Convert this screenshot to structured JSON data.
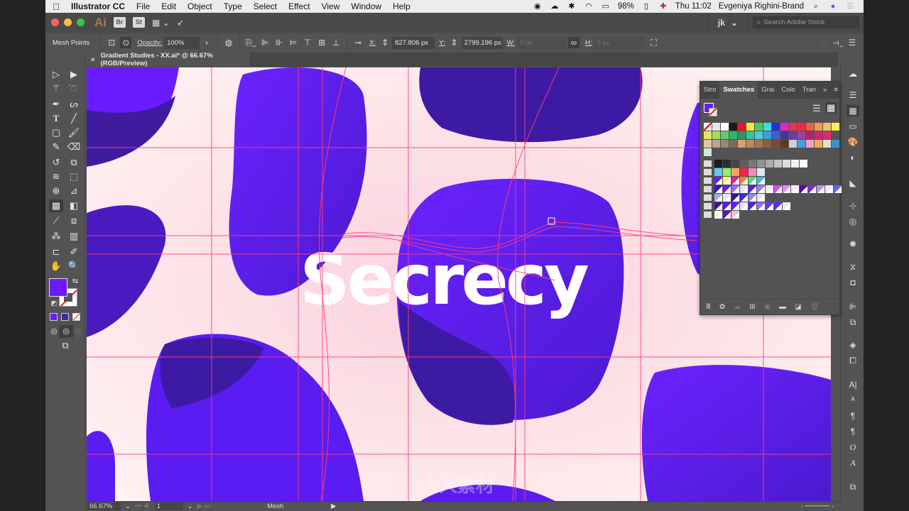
{
  "menubar": {
    "app_name": "Illustrator CC",
    "items": [
      "File",
      "Edit",
      "Object",
      "Type",
      "Select",
      "Effect",
      "View",
      "Window",
      "Help"
    ],
    "battery": "98%",
    "clock": "Thu 11:02",
    "user": "Evgeniya Righini-Brand"
  },
  "appbar": {
    "logo": "Ai",
    "bridge_label": "Br",
    "stock_label": "St",
    "workspace_user": "jk",
    "search_placeholder": "Search Adobe Stock"
  },
  "control_bar": {
    "selection_label": "Mesh Points",
    "opacity_label": "Opacity:",
    "opacity_value": "100%",
    "x_label": "X:",
    "x_value": "827.806 px",
    "y_label": "Y:",
    "y_value": "2799.196 px",
    "w_label": "W:",
    "w_value": "0 px",
    "h_label": "H:",
    "h_value": "0 px"
  },
  "document": {
    "tab_title": "Gradient Studies - XX.ai* @ 66.67% (RGB/Preview)",
    "artwork_text": "Secrecy"
  },
  "colors": {
    "fill": "#6a1bff",
    "stroke": "none",
    "mesh_line": "#ff3d7f",
    "canvas_light": "#fdeef0",
    "blob_violet": "#5a1cf0",
    "blob_dark": "#3d1aa3"
  },
  "swatches_panel": {
    "tabs": [
      "Stro",
      "Swatches",
      "Grai",
      "Colo",
      "Tran"
    ],
    "active_tab": "Swatches",
    "rows": [
      [
        "none",
        "#e8e8e8",
        "#ffffff",
        "#1a1a1a",
        "#e8132c",
        "#f8e83a",
        "#3ad45e",
        "#40d7e8",
        "#2433d8",
        "#e223d6",
        "#e8324f",
        "#ea2d4b",
        "#f25a4a",
        "#f49a4c",
        "#f6bf5b",
        "#f9ef5e"
      ],
      [
        "#e9e45c",
        "#a9d95c",
        "#5ecf6a",
        "#35b36a",
        "#2e9463",
        "#34c39c",
        "#56c5e2",
        "#3d9fd6",
        "#3d63bf",
        "#3a3b9f",
        "#6d3ba3",
        "#a03f9f",
        "#b0246d",
        "#d6226d",
        "#e22a74"
      ],
      [
        "#e2c8a8",
        "#b7a592",
        "#998777",
        "#7c6a5e",
        "#d8a06e",
        "#c08a5c",
        "#a87450",
        "#8e5e3f",
        "#784c31",
        "#5b3a26",
        "#d0d0d0",
        "#3aa3e8",
        "#f2a0c8",
        "#f6a95a",
        "#e0e0d0",
        "#3e8fd0"
      ],
      [
        "#d0ecd0"
      ]
    ],
    "group_rows": [
      [
        "#1d1d1d",
        "#2e2e2e",
        "#454545",
        "#5e5e5e",
        "#787878",
        "#939393",
        "#ababab",
        "#c4c4c4",
        "#dcdcdc",
        "#f2f2f2",
        "#ffffff"
      ],
      [
        "#5fc8f2",
        "#8ef06c",
        "#f6a45c",
        "#f2244c",
        "#f58ac0",
        "#dde8f2"
      ],
      [
        "#6a1bff",
        "#f8f06a",
        "#ee1a8e",
        "#f48032",
        "#4fe06a",
        "#38bde8"
      ],
      [
        "#3d1aa3",
        "#6a1bff",
        "#a06af0",
        "#e8defa",
        "#5a1cf0",
        "#a07af2",
        "#efe4fb",
        "#d84bf0",
        "#e08ef5",
        "#f4e6fb",
        "#4a1880",
        "#8a28d8",
        "#c08ef0",
        "#f4e2fb",
        "#5a6af8"
      ],
      [
        "#a0aaf8",
        "#ece6fb",
        "#2a1a8a",
        "#3a2ad8",
        "#8a8af0",
        "#ece6fb"
      ],
      [
        "#3a1a88",
        "#5a1ce0",
        "#6a1bff",
        "#e8defa",
        "#5224d8",
        "#9a6af0",
        "#6a3ad8",
        "#5a2af0",
        "#efe6fb"
      ],
      [
        "#f8f4e8",
        "#4a1ad0",
        "#f6bcd0"
      ]
    ]
  },
  "status_bar": {
    "zoom": "66.67%",
    "artboard": "1",
    "tool": "Mesh"
  },
  "watermark": "人人素材"
}
